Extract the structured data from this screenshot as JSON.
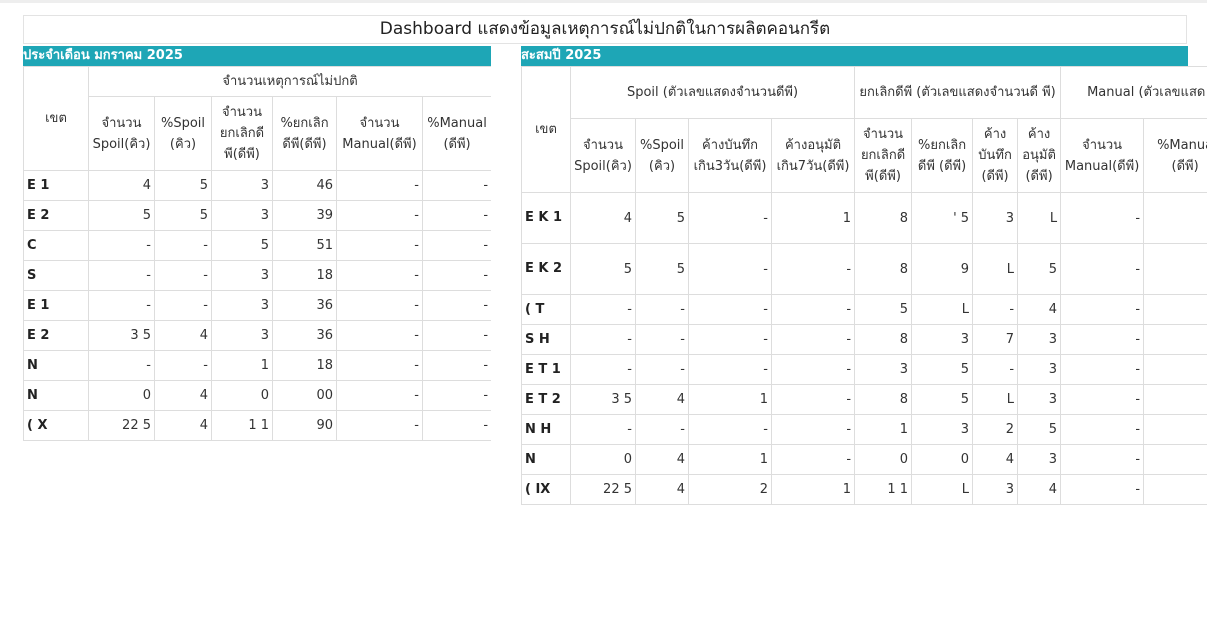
{
  "title": "Dashboard แสดงข้อมูลเหตุการณ์ไม่ปกติในการผลิตคอนกรีต",
  "left": {
    "header": "ประจำเดือน มกราคม 2025",
    "zone_header": "เขต",
    "group_header": "จำนวนเหตุการณ์ไม่ปกติ",
    "columns": [
      "จำนวน Spoil(คิว)",
      "%Spoil (คิว)",
      "จำนวน ยกเลิกดี พี(ดีพี)",
      "%ยกเลิก ดีพี(ดีพี)",
      "จำนวน Manual(ดีพี)",
      "%Manual (ดีพี)"
    ],
    "rows": [
      {
        "zone": "E 1",
        "cells": [
          "4",
          "5",
          "3",
          "46",
          "-",
          "-"
        ]
      },
      {
        "zone": "E 2",
        "cells": [
          "5",
          "5",
          "3",
          "39",
          "-",
          "-"
        ]
      },
      {
        "zone": "C",
        "cells": [
          "-",
          "-",
          "5",
          "51",
          "-",
          "-"
        ]
      },
      {
        "zone": "S",
        "cells": [
          "-",
          "-",
          "3",
          "18",
          "-",
          "-"
        ]
      },
      {
        "zone": "E 1",
        "cells": [
          "-",
          "-",
          "3",
          "36",
          "-",
          "-"
        ]
      },
      {
        "zone": "E 2",
        "cells": [
          "3 5",
          "4",
          "3",
          "36",
          "-",
          "-"
        ]
      },
      {
        "zone": "N",
        "cells": [
          "-",
          "-",
          "1",
          "18",
          "-",
          "-"
        ]
      },
      {
        "zone": "N",
        "cells": [
          "0",
          "4",
          "0",
          "00",
          "-",
          "-"
        ]
      },
      {
        "zone": "( X",
        "cells": [
          "22 5",
          "4",
          "1 1",
          "90",
          "-",
          "-"
        ]
      }
    ]
  },
  "right": {
    "header": "สะสมปี 2025",
    "zone_header": "เขต",
    "groups": [
      "Spoil (ตัวเลขแสดงจำนวนดีพี)",
      "ยกเลิกดีพี (ตัวเลขแสดงจำนวนดี พี)",
      "Manual (ตัวเลขแสด"
    ],
    "columns": [
      "จำนวน Spoil(คิว)",
      "%Spoil (คิว)",
      "ค้างบันทึก เกิน3วัน(ดีพี)",
      "ค้างอนุมัติ เกิน7วัน(ดีพี)",
      "จำนวน ยกเลิกดี พี(ดีพี)",
      "%ยกเลิก ดีพี (ดีพี)",
      "ค้าง บันทึก (ดีพี)",
      "ค้าง อนุมัติ (ดีพี)",
      "จำนวน Manual(ดีพี)",
      "%Manua (ดีพี)"
    ],
    "rows": [
      {
        "zone": "E K 1",
        "cells": [
          "4",
          "5",
          "-",
          "1",
          "8",
          "' 5",
          "3",
          "L",
          "-",
          "-"
        ]
      },
      {
        "zone": "E K 2",
        "cells": [
          "5",
          "5",
          "-",
          "-",
          "8",
          "9",
          "L",
          "5",
          "-",
          "-"
        ]
      },
      {
        "zone": "( T",
        "cells": [
          "-",
          "-",
          "-",
          "-",
          "5",
          "L",
          "-",
          "4",
          "-",
          "-"
        ]
      },
      {
        "zone": "S H",
        "cells": [
          "-",
          "-",
          "-",
          "-",
          "8",
          "3",
          "7",
          "3",
          "-",
          "-"
        ]
      },
      {
        "zone": "E T 1",
        "cells": [
          "-",
          "-",
          "-",
          "-",
          "3",
          "5",
          "-",
          "3",
          "-",
          "-"
        ]
      },
      {
        "zone": "E T 2",
        "cells": [
          "3 5",
          "4",
          "1",
          "-",
          "8",
          "5",
          "L",
          "3",
          "-",
          "-"
        ]
      },
      {
        "zone": "N H",
        "cells": [
          "-",
          "-",
          "-",
          "-",
          "1",
          "3",
          "2",
          "5",
          "-",
          "-"
        ]
      },
      {
        "zone": "N",
        "cells": [
          "0",
          "4",
          "1",
          "-",
          "0",
          "0",
          "4",
          "3",
          "-",
          "-"
        ]
      },
      {
        "zone": "( IX",
        "cells": [
          "22 5",
          "4",
          "2",
          "1",
          "1 1",
          "L",
          "3",
          "4",
          "-",
          "-"
        ]
      }
    ]
  },
  "colors": {
    "accent": "#1ea6b6",
    "border": "#dddddd",
    "text": "#333333"
  }
}
